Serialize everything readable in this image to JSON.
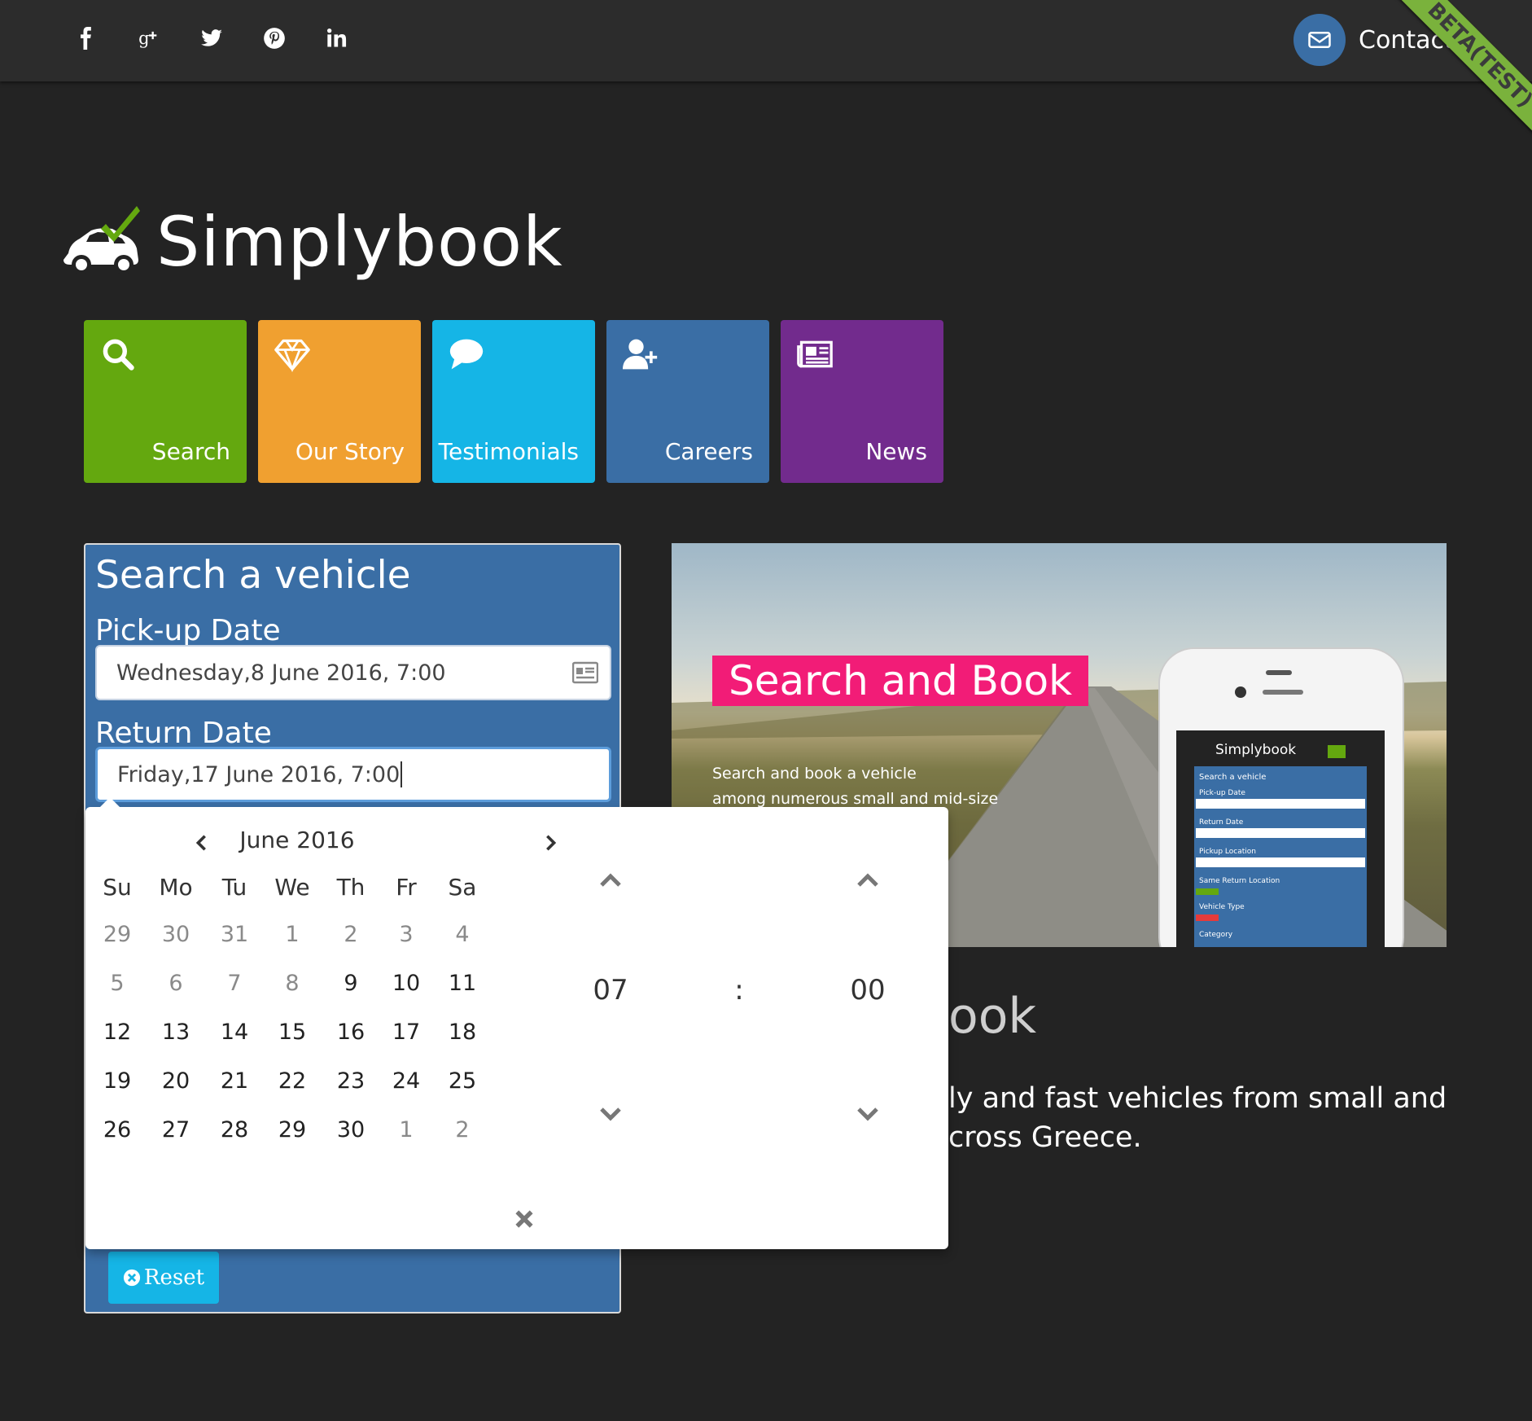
{
  "topbar": {
    "social_icons": [
      "facebook-icon",
      "google-plus-icon",
      "twitter-icon",
      "pinterest-icon",
      "linkedin-icon"
    ],
    "contact_label": "Contact",
    "ribbon": "BETA(TEST)"
  },
  "brand": {
    "name": "Simplybook",
    "accent": "#64a80f"
  },
  "tiles": [
    {
      "label": "Search",
      "icon": "search-icon",
      "color": "#64a80f"
    },
    {
      "label": "Our Story",
      "icon": "diamond-icon",
      "color": "#f0a030"
    },
    {
      "label": "Testimonials",
      "icon": "comment-icon",
      "color": "#15b5e6"
    },
    {
      "label": "Careers",
      "icon": "user-plus-icon",
      "color": "#3a6ea5"
    },
    {
      "label": "News",
      "icon": "newspaper-icon",
      "color": "#722b8d"
    }
  ],
  "search_form": {
    "title": "Search a vehicle",
    "pickup_label": "Pick-up Date",
    "pickup_value": "Wednesday,8 June 2016, 7:00",
    "return_label": "Return Date",
    "return_value": "Friday,17 June 2016, 7:00",
    "reset_label": "Reset"
  },
  "hero": {
    "banner": "Search and Book",
    "sub_line1": "Search and book a vehicle",
    "sub_line2": "among numerous small and mid-size",
    "phone": {
      "title": "Simplybook",
      "form_title": "Search a vehicle",
      "fields": [
        "Pick-up Date",
        "Return Date",
        "Pickup Location",
        "Same Return Location",
        "Vehicle Type",
        "Category"
      ]
    }
  },
  "behind": {
    "heading": "ook",
    "line1": "ly and fast vehicles from small and",
    "line2": "cross Greece."
  },
  "datepicker": {
    "month": "June 2016",
    "dow": [
      "Su",
      "Mo",
      "Tu",
      "We",
      "Th",
      "Fr",
      "Sa"
    ],
    "weeks": [
      [
        "29",
        "30",
        "31",
        "1",
        "2",
        "3",
        "4"
      ],
      [
        "5",
        "6",
        "7",
        "8",
        "9",
        "10",
        "11"
      ],
      [
        "12",
        "13",
        "14",
        "15",
        "16",
        "17",
        "18"
      ],
      [
        "19",
        "20",
        "21",
        "22",
        "23",
        "24",
        "25"
      ],
      [
        "26",
        "27",
        "28",
        "29",
        "30",
        "1",
        "2"
      ]
    ],
    "old_days": [
      [
        0,
        0
      ],
      [
        0,
        1
      ],
      [
        0,
        2
      ],
      [
        0,
        3
      ],
      [
        0,
        4
      ],
      [
        0,
        5
      ],
      [
        0,
        6
      ],
      [
        1,
        0
      ],
      [
        1,
        1
      ],
      [
        1,
        2
      ],
      [
        1,
        3
      ],
      [
        4,
        5
      ],
      [
        4,
        6
      ]
    ],
    "hour": "07",
    "separator": ":",
    "minute": "00"
  }
}
